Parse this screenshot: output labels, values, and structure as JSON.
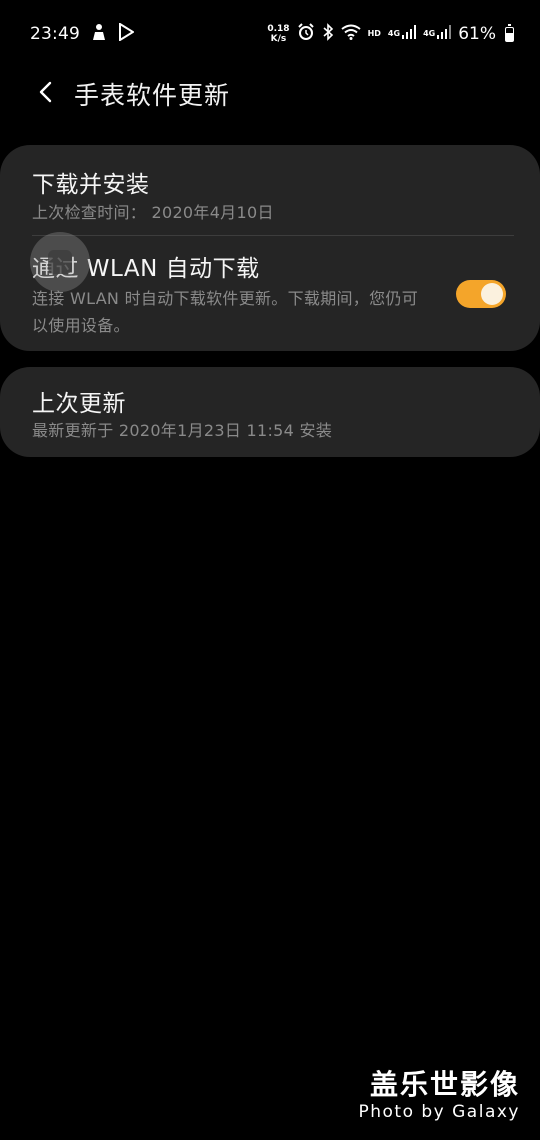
{
  "status_bar": {
    "time": "23:49",
    "net_speed_value": "0.18",
    "net_speed_unit": "K/s",
    "hd_label": "HD",
    "net_type_1": "4G",
    "net_type_2": "4G",
    "battery_percent": "61%",
    "icons": [
      "person-notification-icon",
      "play-store-icon",
      "alarm-icon",
      "bluetooth-icon",
      "wifi-icon",
      "signal-icon",
      "battery-icon"
    ]
  },
  "header": {
    "title": "手表软件更新",
    "back_icon": "chevron-left-icon"
  },
  "settings": {
    "download_install": {
      "title": "下载并安装",
      "subtitle": "上次检查时间： 2020年4月10日"
    },
    "wlan_auto_download": {
      "title": "通过 WLAN 自动下载",
      "subtitle": "连接 WLAN 时自动下载软件更新。下载期间，您仍可以使用设备。",
      "enabled": true
    },
    "last_update": {
      "title": "上次更新",
      "subtitle": "最新更新于 2020年1月23日 11:54 安装"
    }
  },
  "colors": {
    "background": "#000000",
    "card": "#252525",
    "toggle_on": "#f4a52a",
    "secondary_text": "#8a8a8a"
  },
  "watermark": {
    "title": "盖乐世影像",
    "subtitle": "Photo by Galaxy"
  }
}
